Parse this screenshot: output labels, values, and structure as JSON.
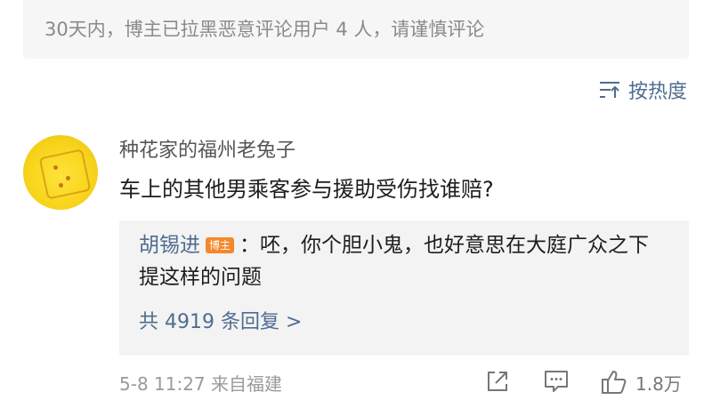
{
  "notice": {
    "text": "30天内，博主已拉黑恶意评论用户 4 人，请谨慎评论"
  },
  "sort": {
    "label": "按热度",
    "icon": "sort-lines-icon"
  },
  "comment": {
    "username": "种花家的福州老兔子",
    "text": "车上的其他男乘客参与援助受伤找谁赔?",
    "reply": {
      "author": "胡锡进",
      "badge": "博主",
      "separator": "：",
      "text": "呸，你个胆小鬼，也好意思在大庭广众之下提这样的问题",
      "more_label": "共 4919 条回复 >"
    },
    "timestamp": "5-8 11:27  来自福建",
    "like_count": "1.8万"
  },
  "colors": {
    "link": "#4f6d90",
    "badge": "#f5872a",
    "muted": "#9a9a9a"
  }
}
